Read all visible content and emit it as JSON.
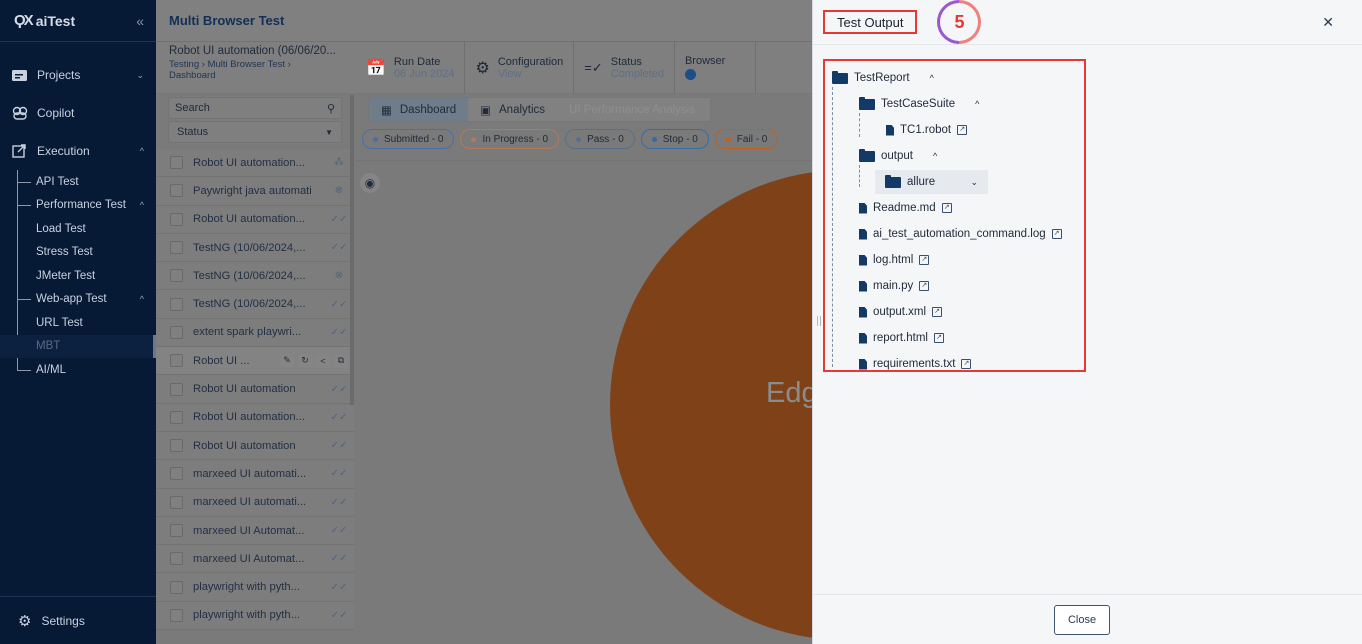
{
  "sidebar": {
    "logo": "aiTest",
    "collapse_glyph": "«",
    "items": [
      {
        "label": "Projects"
      },
      {
        "label": "Copilot"
      },
      {
        "label": "Execution"
      }
    ],
    "execution_sub": [
      {
        "label": "API Test"
      },
      {
        "label": "Performance Test"
      },
      {
        "label": "Load Test"
      },
      {
        "label": "Stress Test"
      },
      {
        "label": "JMeter Test"
      },
      {
        "label": "Web-app Test"
      },
      {
        "label": "URL Test"
      },
      {
        "label": "MBT"
      },
      {
        "label": "AI/ML"
      }
    ],
    "settings": "Settings"
  },
  "header": {
    "title": "Multi Browser Test"
  },
  "subheader": {
    "run_name": "Robot UI automation (06/06/20...",
    "breadcrumb": [
      "Testing",
      "Multi Browser Test",
      "Dashboard"
    ],
    "run_date_label": "Run Date",
    "run_date_value": "06 Jun 2024",
    "config_label": "Configuration",
    "config_value": "View",
    "status_label": "Status",
    "status_value": "Completed",
    "browser_label": "Browser"
  },
  "list": {
    "search_placeholder": "Search",
    "status_placeholder": "Status",
    "rows": [
      {
        "name": "Robot UI automation...",
        "status": "running"
      },
      {
        "name": "Paywright java automati",
        "status": "failed"
      },
      {
        "name": "Robot UI automation...",
        "status": "done"
      },
      {
        "name": "TestNG (10/06/2024,...",
        "status": "done"
      },
      {
        "name": "TestNG (10/06/2024,...",
        "status": "failed"
      },
      {
        "name": "TestNG (10/06/2024,...",
        "status": "done"
      },
      {
        "name": "extent spark playwri...",
        "status": "done"
      },
      {
        "name": "Robot UI ...",
        "status": "selected"
      },
      {
        "name": "Robot UI automation",
        "status": "done"
      },
      {
        "name": "Robot UI automation...",
        "status": "done"
      },
      {
        "name": "Robot UI automation",
        "status": "done"
      },
      {
        "name": "marxeed UI automati...",
        "status": "done"
      },
      {
        "name": "marxeed UI automati...",
        "status": "done"
      },
      {
        "name": "marxeed UI Automat...",
        "status": "done"
      },
      {
        "name": "marxeed UI Automat...",
        "status": "done"
      },
      {
        "name": "playwright with pyth...",
        "status": "done"
      },
      {
        "name": "playwright with pyth...",
        "status": "done"
      }
    ]
  },
  "tabs": [
    {
      "label": "Dashboard"
    },
    {
      "label": "Analytics"
    },
    {
      "label": "UI Performance Analysis"
    }
  ],
  "chips": [
    {
      "label": "Submitted - 0",
      "color": "#4a6fa5"
    },
    {
      "label": "In Progress - 0",
      "color": "#b07a5a"
    },
    {
      "label": "Pass - 0",
      "color": "#5a6f8a"
    },
    {
      "label": "Stop - 0",
      "color": "#3a6aa5"
    },
    {
      "label": "Fail - 0",
      "color": "#c06020"
    }
  ],
  "canvas": {
    "bubble_label": "Edge",
    "bubble_color": "#7f4218"
  },
  "drawer": {
    "title": "Test Output",
    "step": "5",
    "close_label": "Close",
    "tree": {
      "root": "TestReport",
      "suite": "TestCaseSuite",
      "suite_file": "TC1.robot",
      "output": "output",
      "allure": "allure",
      "files": [
        "Readme.md",
        "ai_test_automation_command.log",
        "log.html",
        "main.py",
        "output.xml",
        "report.html",
        "requirements.txt"
      ]
    }
  }
}
